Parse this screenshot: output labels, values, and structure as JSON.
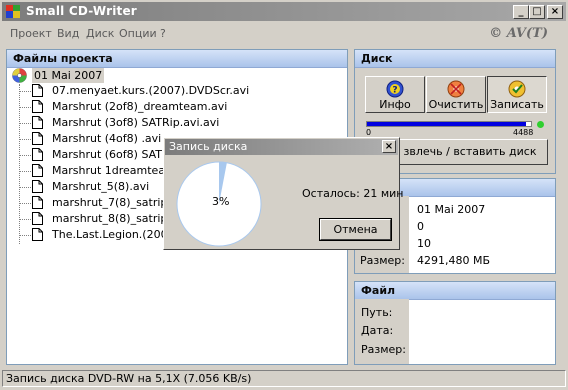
{
  "window": {
    "title": "Small CD-Writer",
    "buttons": [
      "_",
      "□",
      "×"
    ]
  },
  "menu": {
    "items": [
      "Проект",
      "Вид",
      "Диск",
      "Опции",
      "?"
    ],
    "copyright": "© AV(T)"
  },
  "project_panel": {
    "header": "Файлы проекта",
    "root": "01 Mai 2007",
    "files": [
      "07.menyaet.kurs.(2007).DVDScr.avi",
      "Marshrut (2of8)_dreamteam.avi",
      "Marshrut (3of8) SATRip.avi.avi",
      "Marshrut (4of8) .avi",
      "Marshrut (6of8) SATRip",
      "Marshrut 1dreamteam.a",
      "Marshrut_5(8).avi",
      "marshrut_7(8)_satrip_20",
      "marshrut_8(8)_satrip.avi",
      "The.Last.Legion.(2007)."
    ]
  },
  "disk_panel": {
    "header": "Диск",
    "buttons": {
      "info": "Инфо",
      "clear": "Очистить",
      "write": "Записать"
    },
    "capacity_fraction": 0.97,
    "scale_min": "0",
    "scale_max": "4488",
    "eject_button": "звлечь / вставить диск"
  },
  "details_panel": {
    "rows": [
      {
        "label": "",
        "value": "01 Mai 2007"
      },
      {
        "label": "",
        "value": "0"
      },
      {
        "label": "",
        "value": "10"
      },
      {
        "label": "Размер:",
        "value": "4291,480 МБ"
      }
    ]
  },
  "file_panel": {
    "header": "Файл",
    "labels": [
      "Путь:",
      "Дата:",
      "Размер:"
    ]
  },
  "status": {
    "text": "Запись диска DVD-RW на 5,1X (7.056 KB/s)"
  },
  "dialog": {
    "title": "Запись диска",
    "close": "×",
    "progress_percent": 3,
    "progress_label": "3%",
    "remaining": "Осталось: 21 мин",
    "cancel": "Отмена"
  },
  "colors": {
    "panel_header_top": "#d5e3f8",
    "panel_header_bottom": "#aac3ea",
    "progress_fill": "#0000e0",
    "pie_slice": "#a8c8ee",
    "led": "#2fcf2f"
  }
}
